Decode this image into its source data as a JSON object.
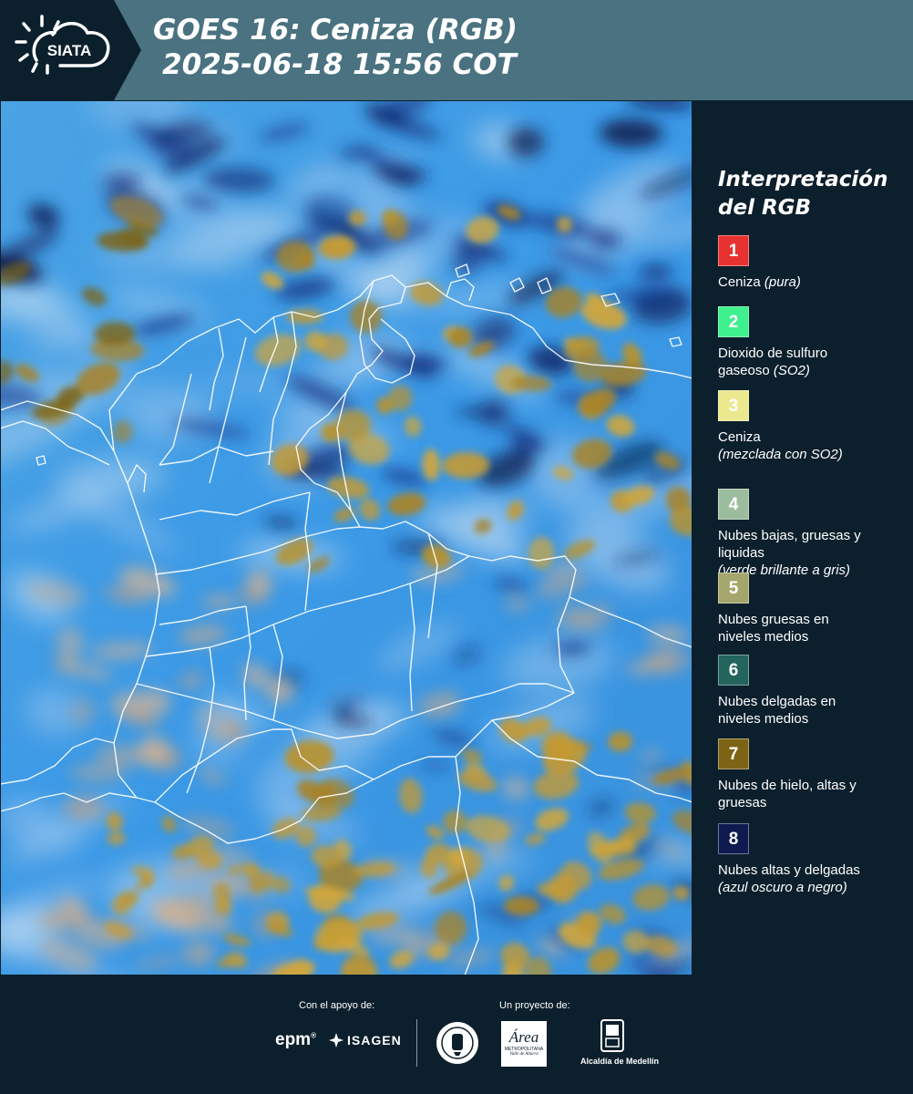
{
  "header": {
    "logo_text": "SIATA",
    "title_line1": "GOES 16: Ceniza (RGB)",
    "title_line2": "2025-06-18 15:56 COT",
    "bg_color": "#4a7280"
  },
  "legend": {
    "title_line1": "Interpretación",
    "title_line2": "del RGB",
    "items": [
      {
        "num": "1",
        "color": "#e83232",
        "lines": [
          "Ceniza"
        ],
        "italic": "(pura)",
        "italic_inline": true
      },
      {
        "num": "2",
        "color": "#3ef08e",
        "lines": [
          "Dioxido de sulfuro",
          "gaseoso"
        ],
        "italic": "(SO2)",
        "italic_inline": true
      },
      {
        "num": "3",
        "color": "#ece88e",
        "lines": [
          "Ceniza"
        ],
        "italic": "(mezclada con SO2)",
        "italic_inline": false
      },
      {
        "num": "4",
        "color": "#9bbd9e",
        "lines": [
          "Nubes bajas, gruesas y",
          "liquidas"
        ],
        "italic": "(verde brillante a gris)",
        "italic_inline": false
      },
      {
        "num": "5",
        "color": "#a5a66c",
        "lines": [
          "Nubes gruesas en",
          "niveles medios"
        ],
        "italic": "",
        "italic_inline": false
      },
      {
        "num": "6",
        "color": "#23645c",
        "lines": [
          "Nubes delgadas en",
          "niveles medios"
        ],
        "italic": "",
        "italic_inline": false
      },
      {
        "num": "7",
        "color": "#7d6414",
        "lines": [
          "Nubes de hielo, altas y",
          "gruesas"
        ],
        "italic": "",
        "italic_inline": false
      },
      {
        "num": "8",
        "color": "#0e1a50",
        "lines": [
          "Nubes altas y delgadas"
        ],
        "italic": "(azul oscuro a negro)",
        "italic_inline": false
      }
    ]
  },
  "footer": {
    "support_label": "Con el apoyo de:",
    "project_label": "Un proyecto de:",
    "sponsor_epm": "epm",
    "sponsor_isagen": "ISAGEN",
    "area_text": "Área",
    "area_sub1": "METROPOLITANA",
    "area_sub2": "Valle de Aburrá",
    "alcaldia_text": "Alcaldía de Medellín"
  }
}
